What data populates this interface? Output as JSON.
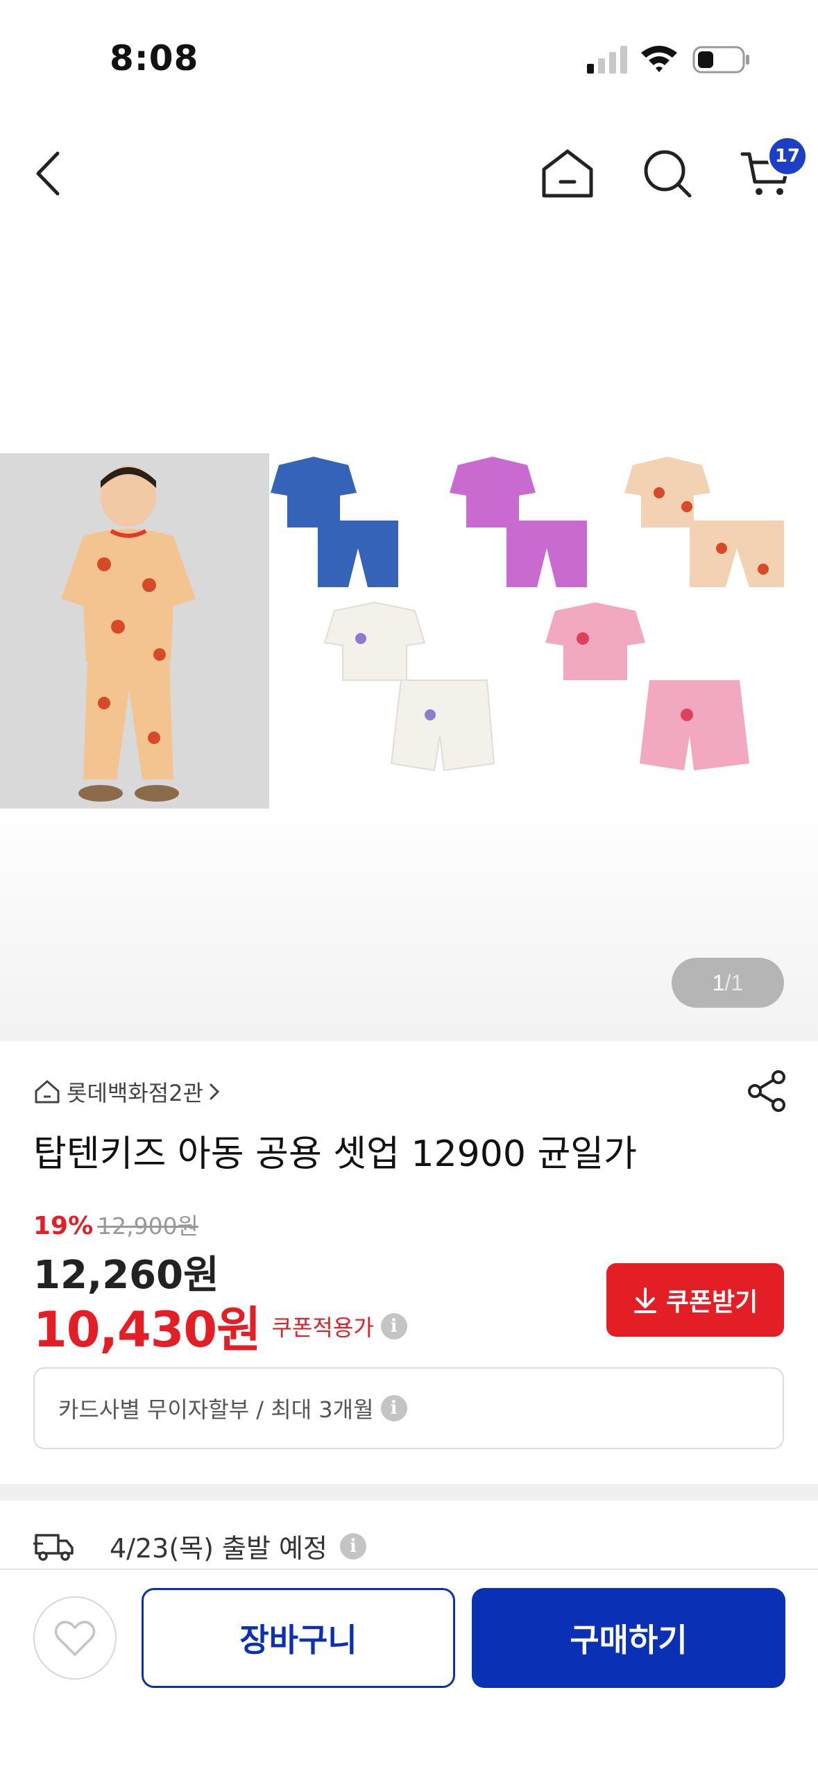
{
  "status_bar": {
    "time": "8:08"
  },
  "nav": {
    "back_icon": "chevron-left-icon",
    "home_icon": "home-icon",
    "search_icon": "search-icon",
    "cart_icon": "cart-icon",
    "cart_count": "17"
  },
  "gallery": {
    "page_current": "1",
    "page_separator": "/",
    "page_total": "1"
  },
  "product": {
    "store_name": "롯데백화점2관",
    "title": "탑텐키즈 아동 공용 셋업 12900 균일가",
    "discount_rate": "19%",
    "original_price": "12,900원",
    "sale_price": "12,260원",
    "coupon_price": "10,430원",
    "coupon_price_label": "쿠폰적용가",
    "coupon_button_label": "쿠폰받기",
    "installment_text": "카드사별 무이자할부 / 최대 3개월",
    "shipping_text": "4/23(목) 출발 예정"
  },
  "bottom_bar": {
    "cart_label": "장바구니",
    "buy_label": "구매하기"
  },
  "colors": {
    "accent_blue": "#0a30b5",
    "badge_blue": "#1d3ec7",
    "sale_red": "#e31e24"
  }
}
